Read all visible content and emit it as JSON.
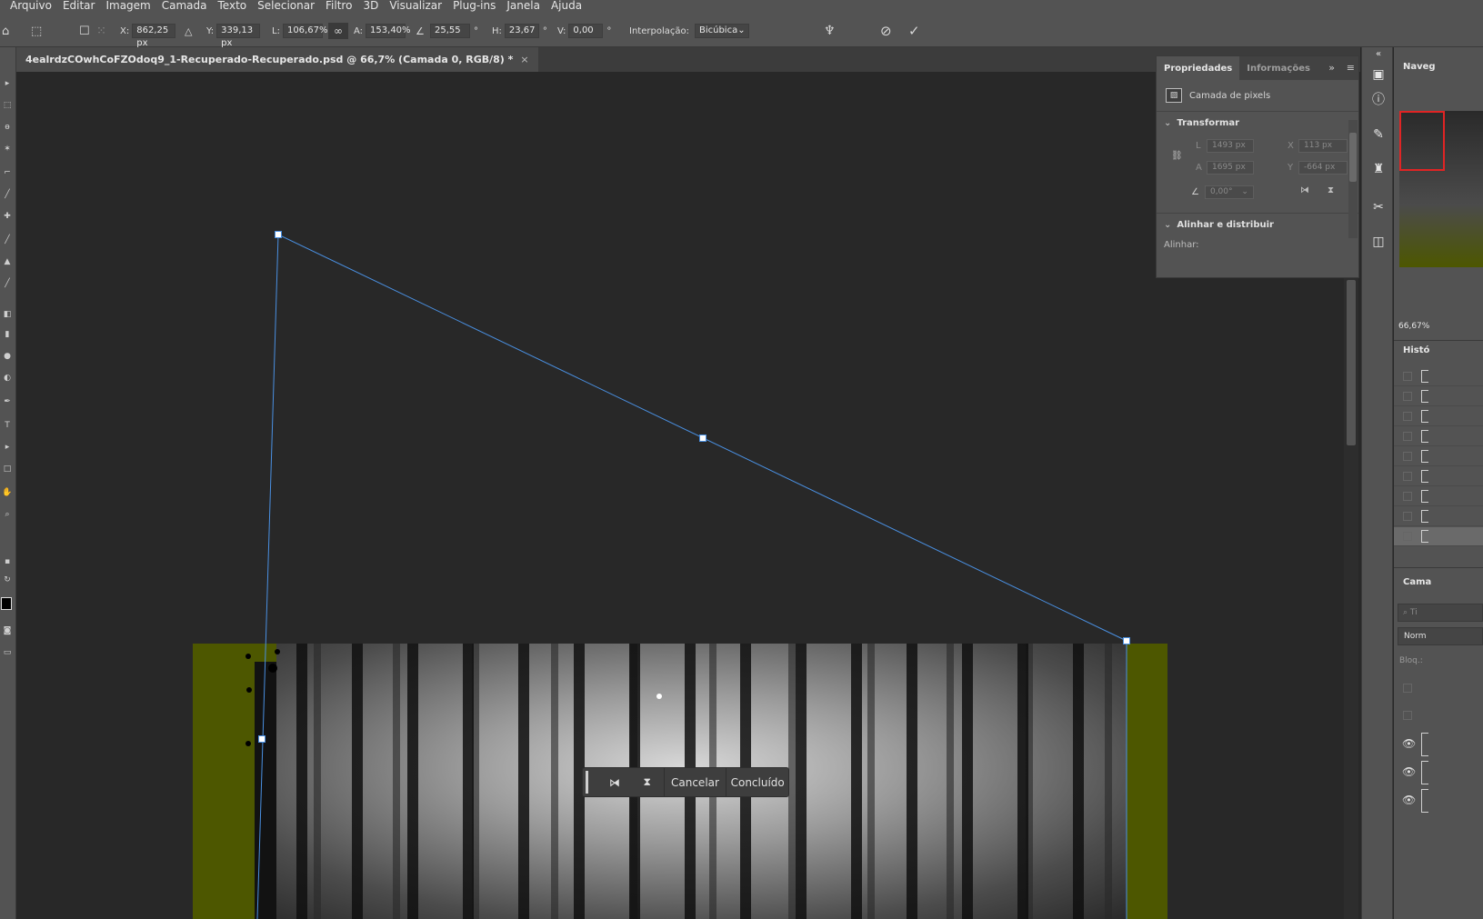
{
  "menu": [
    "Arquivo",
    "Editar",
    "Imagem",
    "Camada",
    "Texto",
    "Selecionar",
    "Filtro",
    "3D",
    "Visualizar",
    "Plug-ins",
    "Janela",
    "Ajuda"
  ],
  "options": {
    "x_label": "X:",
    "x_value": "862,25 px",
    "y_label": "Y:",
    "y_value": "339,13 px",
    "w_label": "L:",
    "w_value": "106,67%",
    "h_label": "A:",
    "h_value": "153,40%",
    "rotate_value": "25,55",
    "deg": "°",
    "hskew_label": "H:",
    "hskew_value": "23,67",
    "vskew_label": "V:",
    "vskew_value": "0,00",
    "interp_label": "Interpolação:",
    "interp_value": "Bicúbica"
  },
  "document": {
    "tab_title": "4ealrdzCOwhCoFZOdoq9_1-Recuperado-Recuperado.psd @ 66,7% (Camada 0, RGB/8) *",
    "close": "×"
  },
  "commit_bar": {
    "cancel": "Cancelar",
    "done": "Concluído"
  },
  "properties": {
    "tab_properties": "Propriedades",
    "tab_info": "Informações",
    "layer_kind": "Camada de pixels",
    "transform_title": "Transformar",
    "w_label": "L",
    "w_value": "1493 px",
    "x_label": "X",
    "x_value": "113 px",
    "h_label": "A",
    "h_value": "1695 px",
    "y_label": "Y",
    "y_value": "-664 px",
    "angle_value": "0,00°",
    "align_title": "Alinhar e distribuir",
    "align_label": "Alinhar:"
  },
  "right": {
    "navigator": "Naveg",
    "zoom": "66,67%",
    "history": "Histó",
    "layers": "Cama",
    "search_placeholder": "Ti",
    "blend_mode": "Norm",
    "lock_label": "Bloq.:"
  },
  "colors": {
    "ui_panel": "#535353",
    "canvas_bg": "#282828",
    "green_fill": "#4d5700",
    "transform_line": "#4a90e2",
    "nav_highlight": "#e02424"
  }
}
